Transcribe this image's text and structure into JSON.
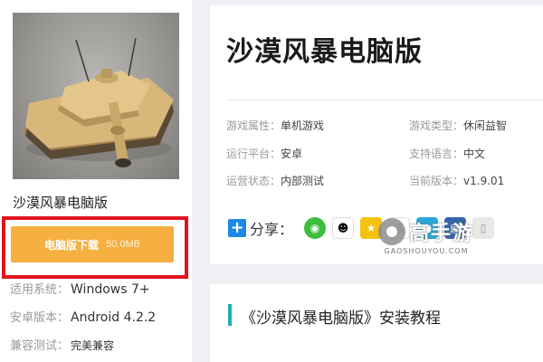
{
  "game": {
    "title": "沙漠风暴电脑版",
    "cover_icon": "tank-image"
  },
  "download": {
    "label": "电脑版下载",
    "size": "50.0MB",
    "button_color": "#f5b041",
    "highlight_color": "#e0141e"
  },
  "specs": [
    {
      "key": "适用系统：",
      "value": "Windows 7+"
    },
    {
      "key": "安卓版本：",
      "value": "Android 4.2.2"
    },
    {
      "key": "兼容测试：",
      "value": "完美兼容"
    }
  ],
  "attributes": {
    "game_attr": {
      "key": "游戏属性：",
      "value": "单机游戏"
    },
    "game_type": {
      "key": "游戏类型：",
      "value": "休闲益智"
    },
    "platform": {
      "key": "运行平台：",
      "value": "安卓"
    },
    "language": {
      "key": "支持语言：",
      "value": "中文"
    },
    "status": {
      "key": "运营状态：",
      "value": "内部测试"
    },
    "version": {
      "key": "当前版本：",
      "value": "v1.9.01"
    }
  },
  "share": {
    "label": "分享：",
    "icons": [
      "wechat-icon",
      "qq-icon",
      "qzone-icon",
      "weibo-icon",
      "tencent-weibo-icon",
      "renren-icon",
      "more-icon"
    ]
  },
  "watermark": {
    "name": "高手游",
    "domain": "GAOSHOUYOU.COM"
  },
  "tutorial": {
    "title": "《沙漠风暴电脑版》安装教程",
    "accent_color": "#1fb0b0"
  }
}
